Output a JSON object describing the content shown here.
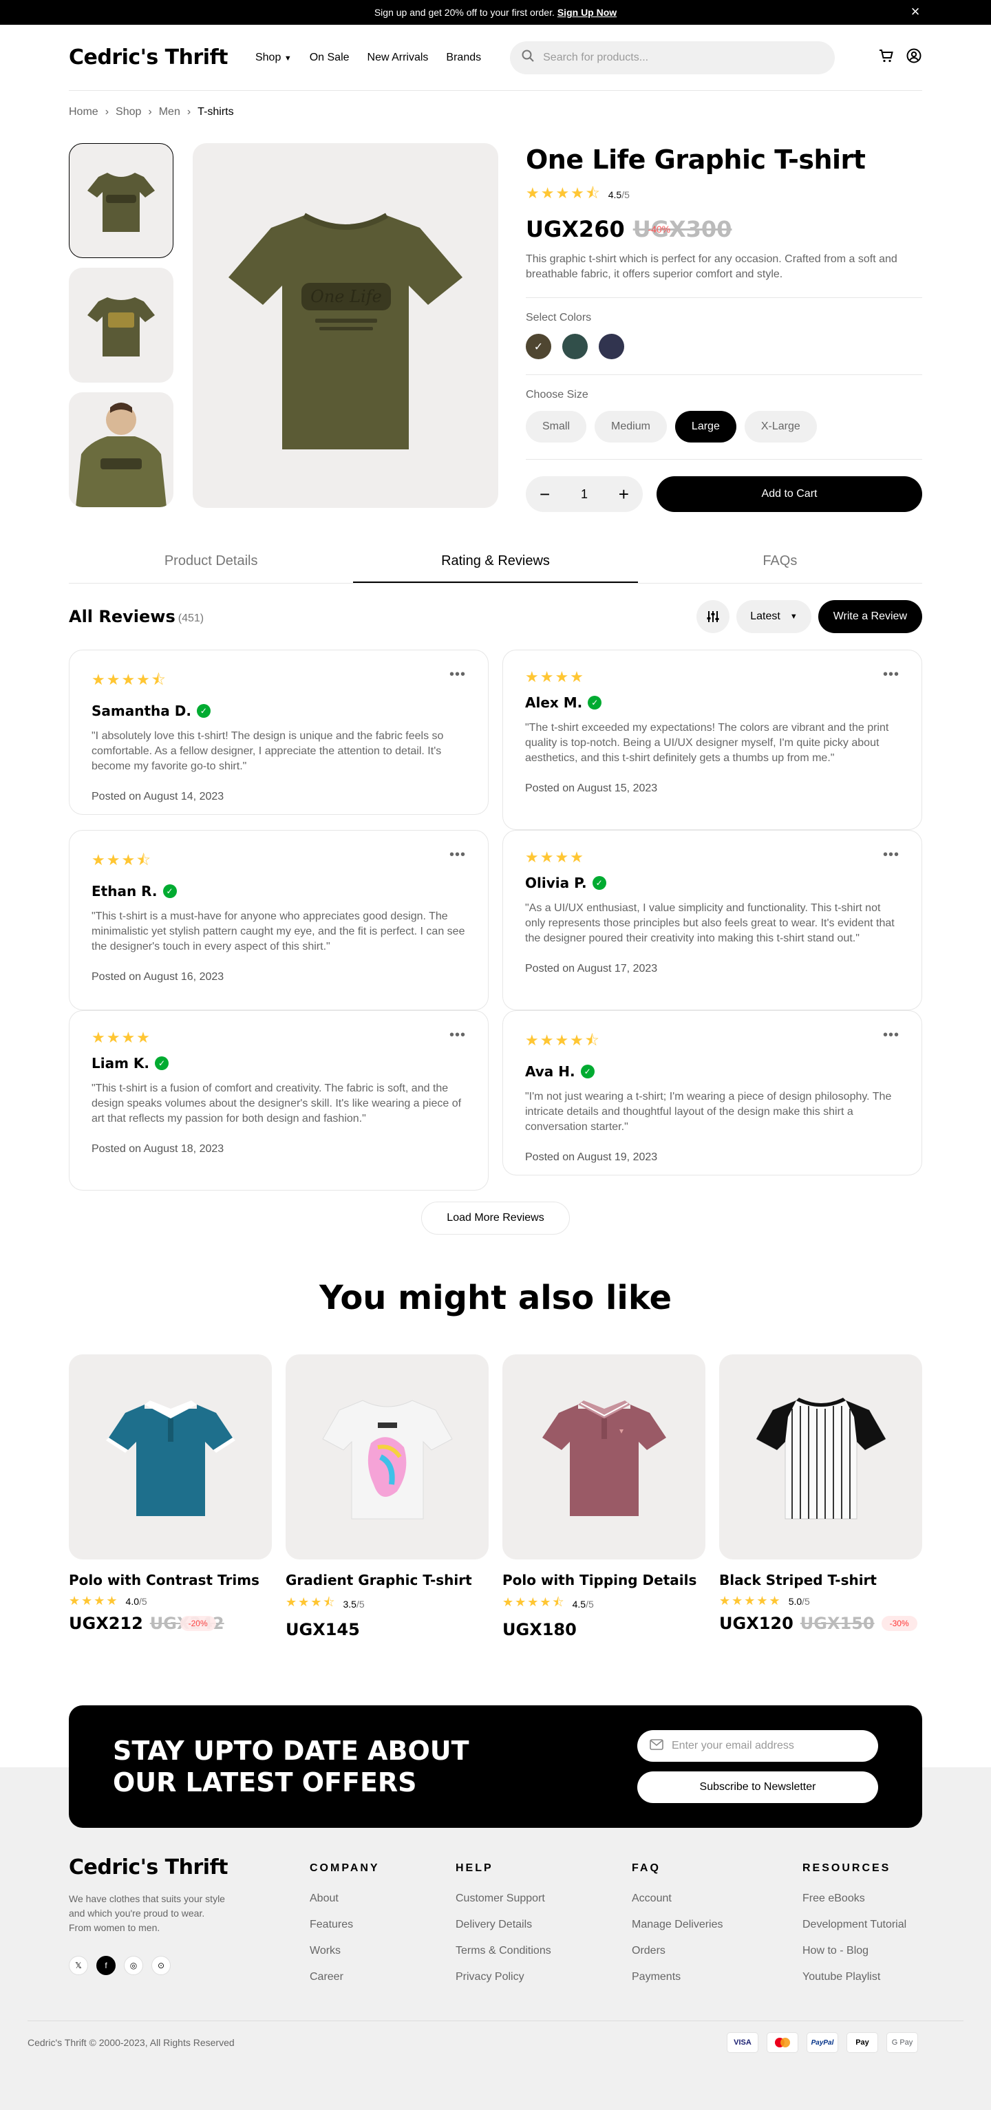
{
  "announcement": {
    "text": "Sign up and get 20% off to your first order.",
    "link": "Sign Up Now",
    "close": "×"
  },
  "header": {
    "logo": "Cedric's Thrift",
    "nav": [
      "Shop",
      "On Sale",
      "New Arrivals",
      "Brands"
    ],
    "search_placeholder": "Search for products..."
  },
  "breadcrumb": [
    "Home",
    "Shop",
    "Men",
    "T-shirts"
  ],
  "product": {
    "title": "One Life Graphic T-shirt",
    "stars": "★★★★⯪",
    "rating": "4.5",
    "rating_max": "/5",
    "price": "UGX260",
    "old_price": "UGX300",
    "discount": "-40%",
    "description": "This graphic t-shirt which is perfect for any occasion. Crafted from a soft and breathable fabric, it offers superior comfort and style.",
    "colors_label": "Select Colors",
    "colors": [
      "#4f4631",
      "#314f4a",
      "#31344f"
    ],
    "size_label": "Choose Size",
    "sizes": [
      "Small",
      "Medium",
      "Large",
      "X-Large"
    ],
    "selected_size": "Large",
    "quantity": "1",
    "add_to_cart": "Add to Cart"
  },
  "tabs": [
    "Product Details",
    "Rating & Reviews",
    "FAQs"
  ],
  "reviews": {
    "title": "All Reviews",
    "count": "(451)",
    "sort": "Latest",
    "write": "Write a Review",
    "items": [
      {
        "stars": "★★★★⯪",
        "name": "Samantha D.",
        "text": "\"I absolutely love this t-shirt! The design is unique and the fabric feels so comfortable. As a fellow designer, I appreciate the attention to detail. It's become my favorite go-to shirt.\"",
        "date": "Posted on August 14, 2023"
      },
      {
        "stars": "★★★★",
        "name": "Alex M.",
        "text": "\"The t-shirt exceeded my expectations! The colors are vibrant and the print quality is top-notch. Being a UI/UX designer myself, I'm quite picky about aesthetics, and this t-shirt definitely gets a thumbs up from me.\"",
        "date": "Posted on August 15, 2023"
      },
      {
        "stars": "★★★⯪",
        "name": "Ethan R.",
        "text": "\"This t-shirt is a must-have for anyone who appreciates good design. The minimalistic yet stylish pattern caught my eye, and the fit is perfect. I can see the designer's touch in every aspect of this shirt.\"",
        "date": "Posted on August 16, 2023"
      },
      {
        "stars": "★★★★",
        "name": "Olivia P.",
        "text": "\"As a UI/UX enthusiast, I value simplicity and functionality. This t-shirt not only represents those principles but also feels great to wear. It's evident that the designer poured their creativity into making this t-shirt stand out.\"",
        "date": "Posted on August 17, 2023"
      },
      {
        "stars": "★★★★",
        "name": "Liam K.",
        "text": "\"This t-shirt is a fusion of comfort and creativity. The fabric is soft, and the design speaks volumes about the designer's skill. It's like wearing a piece of art that reflects my passion for both design and fashion.\"",
        "date": "Posted on August 18, 2023"
      },
      {
        "stars": "★★★★⯪",
        "name": "Ava H.",
        "text": "\"I'm not just wearing a t-shirt; I'm wearing a piece of design philosophy. The intricate details and thoughtful layout of the design make this shirt a conversation starter.\"",
        "date": "Posted on August 19, 2023"
      }
    ],
    "load_more": "Load More Reviews"
  },
  "also_like": {
    "title": "You might also like",
    "items": [
      {
        "name": "Polo with Contrast Trims",
        "stars": "★★★★",
        "rating": "4.0",
        "rating_max": "/5",
        "price": "UGX212",
        "old_price": "UGX242",
        "discount": "-20%"
      },
      {
        "name": "Gradient Graphic T-shirt",
        "stars": "★★★⯪",
        "rating": "3.5",
        "rating_max": "/5",
        "price": "UGX145",
        "old_price": "",
        "discount": ""
      },
      {
        "name": "Polo with Tipping Details",
        "stars": "★★★★⯪",
        "rating": "4.5",
        "rating_max": "/5",
        "price": "UGX180",
        "old_price": "",
        "discount": ""
      },
      {
        "name": "Black Striped T-shirt",
        "stars": "★★★★★",
        "rating": "5.0",
        "rating_max": "/5",
        "price": "UGX120",
        "old_price": "UGX150",
        "discount": "-30%"
      }
    ]
  },
  "newsletter": {
    "title": "STAY UPTO DATE ABOUT OUR LATEST OFFERS",
    "placeholder": "Enter your email address",
    "button": "Subscribe to Newsletter"
  },
  "footer": {
    "logo": "Cedric's Thrift",
    "tagline": "We have clothes that suits your style and which you're proud to wear. From women to men.",
    "columns": [
      {
        "title": "COMPANY",
        "links": [
          "About",
          "Features",
          "Works",
          "Career"
        ]
      },
      {
        "title": "HELP",
        "links": [
          "Customer Support",
          "Delivery Details",
          "Terms & Conditions",
          "Privacy Policy"
        ]
      },
      {
        "title": "FAQ",
        "links": [
          "Account",
          "Manage Deliveries",
          "Orders",
          "Payments"
        ]
      },
      {
        "title": "RESOURCES",
        "links": [
          "Free eBooks",
          "Development Tutorial",
          "How to - Blog",
          "Youtube Playlist"
        ]
      }
    ],
    "copyright": "Cedric's Thrift © 2000-2023, All Rights Reserved",
    "payments": [
      "VISA",
      "",
      "PayPal",
      "Pay",
      "G Pay"
    ]
  }
}
